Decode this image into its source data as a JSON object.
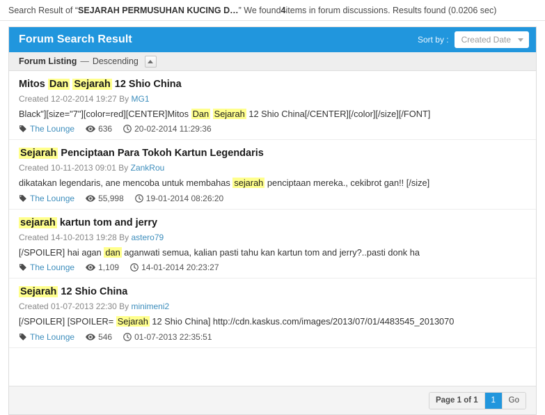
{
  "summary": {
    "prefix": "Search Result of “",
    "query": "SEJARAH PERMUSUHAN KUCING D…",
    "middle": "” We found ",
    "count": "4",
    "suffix": " items in forum discussions. Results found (0.0206 sec)"
  },
  "header": {
    "title": "Forum Search Result",
    "sort_label": "Sort by :",
    "sort_value": "Created Date",
    "sort_caret_icon": "chevron-down-icon"
  },
  "subbar": {
    "listing_label": "Forum Listing",
    "dash": "—",
    "order": "Descending",
    "toggle_icon": "caret-up-icon"
  },
  "icons": {
    "tag": "tag-icon",
    "views": "eye-icon",
    "time": "clock-icon"
  },
  "results": [
    {
      "title_parts": [
        {
          "text": "Mitos ",
          "hl": false
        },
        {
          "text": "Dan",
          "hl": true
        },
        {
          "text": " ",
          "hl": false
        },
        {
          "text": "Sejarah",
          "hl": true
        },
        {
          "text": " 12 Shio China",
          "hl": false
        }
      ],
      "created_label": "Created",
      "created_date": "12-02-2014 19:27",
      "by_label": "By",
      "author": "MG1",
      "snippet_parts": [
        {
          "text": "Black\"][size=\"7\"][color=red][CENTER]Mitos ",
          "hl": false
        },
        {
          "text": "Dan",
          "hl": true
        },
        {
          "text": " ",
          "hl": false
        },
        {
          "text": "Sejarah",
          "hl": true
        },
        {
          "text": " 12 Shio China[/CENTER][/color][/size][/FONT]",
          "hl": false
        }
      ],
      "forum": "The Lounge",
      "views": "636",
      "timestamp": "20-02-2014 11:29:36"
    },
    {
      "title_parts": [
        {
          "text": "Sejarah",
          "hl": true
        },
        {
          "text": " Penciptaan Para Tokoh Kartun Legendaris",
          "hl": false
        }
      ],
      "created_label": "Created",
      "created_date": "10-11-2013 09:01",
      "by_label": "By",
      "author": "ZankRou",
      "snippet_parts": [
        {
          "text": "dikatakan legendaris, ane mencoba untuk membahas ",
          "hl": false
        },
        {
          "text": "sejarah",
          "hl": true
        },
        {
          "text": " penciptaan mereka., cekibrot gan!! [/size]",
          "hl": false
        }
      ],
      "forum": "The Lounge",
      "views": "55,998",
      "timestamp": "19-01-2014 08:26:20"
    },
    {
      "title_parts": [
        {
          "text": "sejarah",
          "hl": true
        },
        {
          "text": " kartun tom and jerry",
          "hl": false
        }
      ],
      "created_label": "Created",
      "created_date": "14-10-2013 19:28",
      "by_label": "By",
      "author": "astero79",
      "snippet_parts": [
        {
          "text": "[/SPOILER] hai agan ",
          "hl": false
        },
        {
          "text": "dan",
          "hl": true
        },
        {
          "text": " aganwati semua, kalian pasti tahu kan kartun tom and jerry?..pasti donk ha",
          "hl": false
        }
      ],
      "forum": "The Lounge",
      "views": "1,109",
      "timestamp": "14-01-2014 20:23:27"
    },
    {
      "title_parts": [
        {
          "text": "Sejarah",
          "hl": true
        },
        {
          "text": " 12 Shio China",
          "hl": false
        }
      ],
      "created_label": "Created",
      "created_date": "01-07-2013 22:30",
      "by_label": "By",
      "author": "minimeni2",
      "snippet_parts": [
        {
          "text": "[/SPOILER] [SPOILER= ",
          "hl": false
        },
        {
          "text": "Sejarah",
          "hl": true
        },
        {
          "text": " 12 Shio China] http://cdn.kaskus.com/images/2013/07/01/4483545_2013070",
          "hl": false
        }
      ],
      "forum": "The Lounge",
      "views": "546",
      "timestamp": "01-07-2013 22:35:51"
    }
  ],
  "pagination": {
    "page_label": "Page 1 of 1",
    "current_page": "1",
    "go_label": "Go"
  },
  "colors": {
    "accent_blue": "#2196dd",
    "highlight_yellow": "#ffff8d",
    "link_blue": "#3c8dbc"
  }
}
